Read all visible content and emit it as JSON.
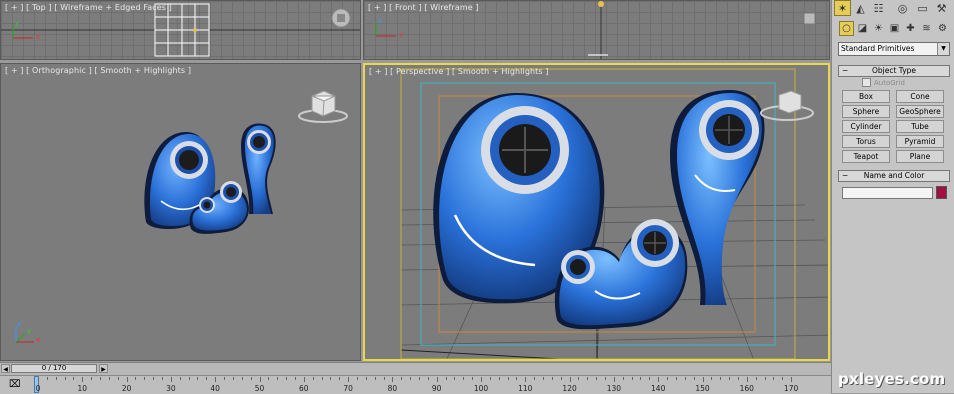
{
  "viewports": {
    "top": {
      "label": "[ + ] [ Top ] [ Wireframe + Edged Faces ]"
    },
    "front": {
      "label": "[ + ] [ Front ] [ Wireframe ]"
    },
    "ortho": {
      "label": "[ + ] [ Orthographic ] [ Smooth + Highlights ]"
    },
    "persp": {
      "label": "[ + ] [ Perspective ] [ Smooth + Highlights ]"
    }
  },
  "axes": {
    "x": "x",
    "y": "y",
    "z": "z"
  },
  "command_panel": {
    "tabs": [
      "create-icon",
      "modify-icon",
      "hierarchy-icon",
      "motion-icon",
      "display-icon",
      "utilities-icon"
    ],
    "subtabs": [
      "geometry-icon",
      "shapes-icon",
      "lights-icon",
      "cameras-icon",
      "helpers-icon",
      "spacewarps-icon",
      "systems-icon"
    ],
    "category": "Standard Primitives",
    "object_type": {
      "title": "Object Type",
      "autogrid": "AutoGrid",
      "buttons": [
        "Box",
        "Cone",
        "Sphere",
        "GeoSphere",
        "Cylinder",
        "Tube",
        "Torus",
        "Pyramid",
        "Teapot",
        "Plane"
      ]
    },
    "name_color": {
      "title": "Name and Color",
      "name_value": "",
      "color": "#a01040"
    }
  },
  "timeline": {
    "frame": "0 / 170",
    "ticks": [
      "0",
      "10",
      "20",
      "30",
      "40",
      "50",
      "60",
      "70",
      "80",
      "90",
      "100",
      "110",
      "120",
      "130",
      "140",
      "150",
      "160",
      "170"
    ]
  },
  "watermark": "pxleyes.com",
  "colors": {
    "active_border": "#e8d84a",
    "object_blue": "#2a6fd6",
    "selection": "#e6cc5a"
  }
}
